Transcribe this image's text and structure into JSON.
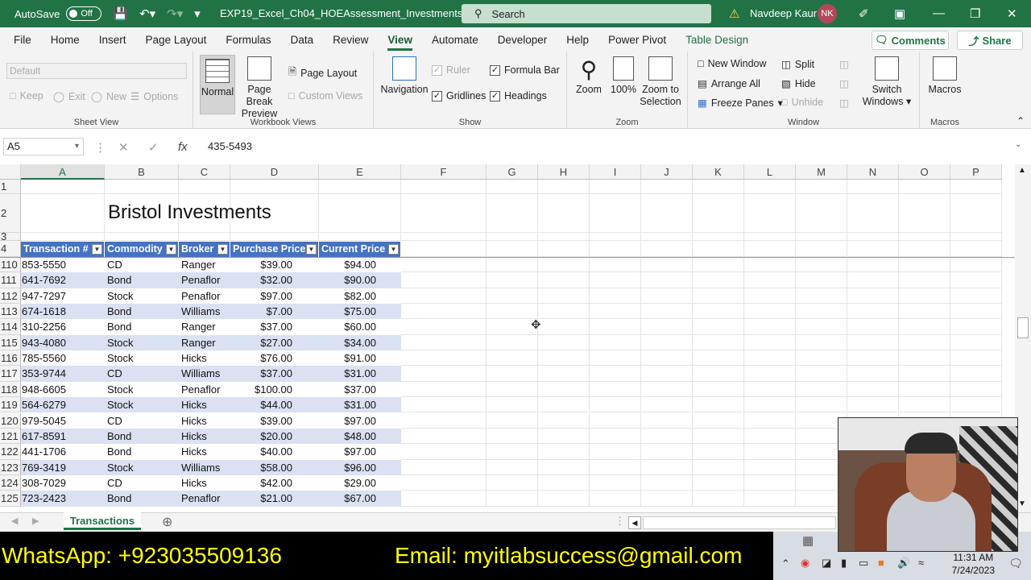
{
  "titlebar": {
    "autosave_label": "AutoSave",
    "autosave_state": "Off",
    "filename": "EXP19_Excel_Ch04_HOEAssessment_Investments  -...",
    "search_placeholder": "Search",
    "user_name": "Navdeep Kaur",
    "user_initials": "NK"
  },
  "tabs": [
    "File",
    "Home",
    "Insert",
    "Page Layout",
    "Formulas",
    "Data",
    "Review",
    "View",
    "Automate",
    "Developer",
    "Help",
    "Power Pivot",
    "Table Design"
  ],
  "active_tab": "View",
  "comments_label": "Comments",
  "share_label": "Share",
  "ribbon": {
    "sheet_view": {
      "label": "Sheet View",
      "dropdown": "Default",
      "keep": "Keep",
      "exit": "Exit",
      "new": "New",
      "options": "Options"
    },
    "workbook_views": {
      "label": "Workbook Views",
      "normal": "Normal",
      "page_break": "Page Break Preview",
      "page_layout": "Page Layout",
      "custom_views": "Custom Views"
    },
    "show": {
      "label": "Show",
      "navigation": "Navigation",
      "ruler": "Ruler",
      "formula_bar": "Formula Bar",
      "gridlines": "Gridlines",
      "headings": "Headings"
    },
    "zoom": {
      "label": "Zoom",
      "zoom": "Zoom",
      "hundred": "100%",
      "zoom_selection": "Zoom to Selection"
    },
    "window": {
      "label": "Window",
      "new_window": "New Window",
      "arrange_all": "Arrange All",
      "freeze_panes": "Freeze Panes",
      "split": "Split",
      "hide": "Hide",
      "unhide": "Unhide",
      "switch_windows": "Switch Windows"
    },
    "macros": {
      "label": "Macros",
      "macros": "Macros"
    }
  },
  "formula_bar": {
    "name_box": "A5",
    "formula": "435-5493"
  },
  "columns": [
    "A",
    "B",
    "C",
    "D",
    "E",
    "F",
    "G",
    "H",
    "I",
    "J",
    "K",
    "L",
    "M",
    "N",
    "O",
    "P"
  ],
  "sheet_title": "Bristol Investments",
  "table_headers": [
    "Transaction #",
    "Commodity",
    "Broker",
    "Purchase Price",
    "Current Price"
  ],
  "rows": [
    [
      "110",
      "853-5550",
      "CD",
      "Ranger",
      "$39.00",
      "$94.00"
    ],
    [
      "111",
      "641-7692",
      "Bond",
      "Penaflor",
      "$32.00",
      "$90.00"
    ],
    [
      "112",
      "947-7297",
      "Stock",
      "Penaflor",
      "$97.00",
      "$82.00"
    ],
    [
      "113",
      "674-1618",
      "Bond",
      "Williams",
      "$7.00",
      "$75.00"
    ],
    [
      "114",
      "310-2256",
      "Bond",
      "Ranger",
      "$37.00",
      "$60.00"
    ],
    [
      "115",
      "943-4080",
      "Stock",
      "Ranger",
      "$27.00",
      "$34.00"
    ],
    [
      "116",
      "785-5560",
      "Stock",
      "Hicks",
      "$76.00",
      "$91.00"
    ],
    [
      "117",
      "353-9744",
      "CD",
      "Williams",
      "$37.00",
      "$31.00"
    ],
    [
      "118",
      "948-6605",
      "Stock",
      "Penaflor",
      "$100.00",
      "$37.00"
    ],
    [
      "119",
      "564-6279",
      "Stock",
      "Hicks",
      "$44.00",
      "$31.00"
    ],
    [
      "120",
      "979-5045",
      "CD",
      "Hicks",
      "$39.00",
      "$97.00"
    ],
    [
      "121",
      "617-8591",
      "Bond",
      "Hicks",
      "$20.00",
      "$48.00"
    ],
    [
      "122",
      "441-1706",
      "Bond",
      "Hicks",
      "$40.00",
      "$97.00"
    ],
    [
      "123",
      "769-3419",
      "Stock",
      "Williams",
      "$58.00",
      "$96.00"
    ],
    [
      "124",
      "308-7029",
      "CD",
      "Hicks",
      "$42.00",
      "$29.00"
    ],
    [
      "125",
      "723-2423",
      "Bond",
      "Penaflor",
      "$21.00",
      "$67.00"
    ]
  ],
  "sheet_tab": "Transactions",
  "overlay": {
    "whatsapp": "WhatsApp: +923035509136",
    "email": "Email: myitlabsuccess@gmail.com"
  },
  "clock": {
    "time": "11:31 AM",
    "date": "7/24/2023"
  }
}
